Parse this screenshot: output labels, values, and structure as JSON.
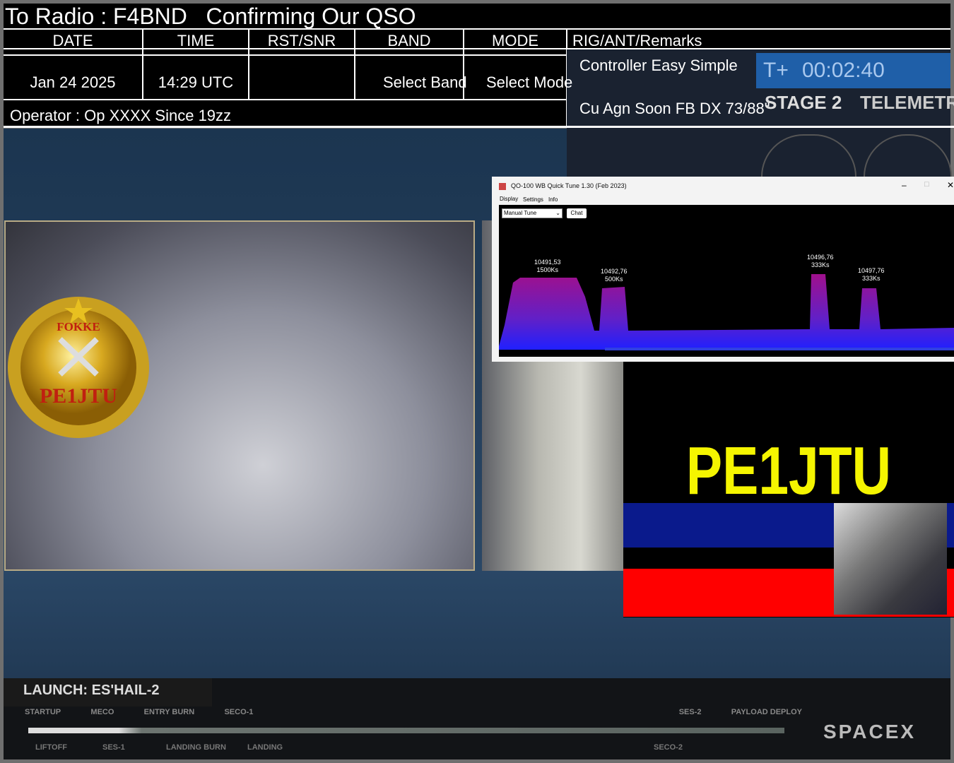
{
  "header": {
    "title": "To Radio : F4BND   Confirming Our QSO",
    "columns": [
      "DATE",
      "TIME",
      "RST/SNR",
      "BAND",
      "MODE",
      "RIG/ANT/Remarks"
    ],
    "values": {
      "date": "Jan 24 2025",
      "time": "14:29 UTC",
      "rst": "",
      "band": "Select Band",
      "mode": "Select Mode"
    },
    "remarks": [
      "Controller Easy Simple",
      "Cu Agn Soon FB DX 73/88\""
    ],
    "operator": "Operator : Op XXXX Since 19zz"
  },
  "broadcast": {
    "timer_prefix": "T+",
    "timer": "00:02:40",
    "stage": "STAGE 2",
    "telemetry": "TELEMETRY",
    "launch": "LAUNCH: ES'HAIL-2",
    "brand": "SPACEX",
    "events_top": [
      "STARTUP",
      "MECO",
      "ENTRY BURN",
      "SECO-1",
      "SES-2",
      "PAYLOAD DEPLOY"
    ],
    "events_bottom": [
      "LIFTOFF",
      "SES-1",
      "LANDING BURN",
      "LANDING",
      "SECO-2"
    ]
  },
  "medal": {
    "name": "FOKKE",
    "call": "PE1JTU"
  },
  "quicktune": {
    "title": "QO-100 WB Quick Tune 1.30 (Feb  2023)",
    "menu": [
      "Display",
      "Settings",
      "Info"
    ],
    "mode_select": "Manual Tune",
    "chat_button": "Chat",
    "signals": [
      {
        "freq": "10491,53",
        "rate": "1500Ks"
      },
      {
        "freq": "10492,76",
        "rate": "500Ks"
      },
      {
        "freq": "10496,76",
        "rate": "333Ks"
      },
      {
        "freq": "10497,76",
        "rate": "333Ks"
      }
    ]
  },
  "callsign": "PE1JTU",
  "colors": {
    "yellow": "#f5f500",
    "blue": "#0a1a8c",
    "red": "#ff0000"
  }
}
